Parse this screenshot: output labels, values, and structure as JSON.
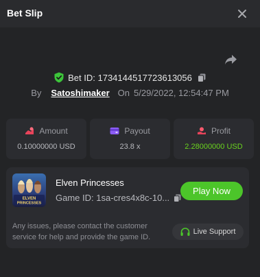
{
  "header": {
    "title": "Bet Slip"
  },
  "bet": {
    "id_label": "Bet ID: 1734144517723613056",
    "by_label": "By",
    "user": "Satoshimaker",
    "on_label": "On",
    "datetime": "5/29/2022, 12:54:47 PM"
  },
  "stats": [
    {
      "label": "Amount",
      "value": "0.10000000 USD",
      "icon": "coin-hand-icon"
    },
    {
      "label": "Payout",
      "value": "23.8 x",
      "icon": "payout-icon"
    },
    {
      "label": "Profit",
      "value": "2.28000000 USD",
      "icon": "profit-icon"
    }
  ],
  "game": {
    "name": "Elven Princesses",
    "id_label": "Game ID: 1sa-cres4x8c-10...",
    "thumb_text_1": "ELVEN",
    "thumb_text_2": "PRINCESSES",
    "play_label": "Play Now",
    "note": "Any issues, please contact the customer service for help and provide the game ID.",
    "support_label": "Live Support"
  },
  "colors": {
    "accent_green": "#4cc52a",
    "profit_green": "#6ad31e",
    "shield_green": "#3cc43a"
  }
}
